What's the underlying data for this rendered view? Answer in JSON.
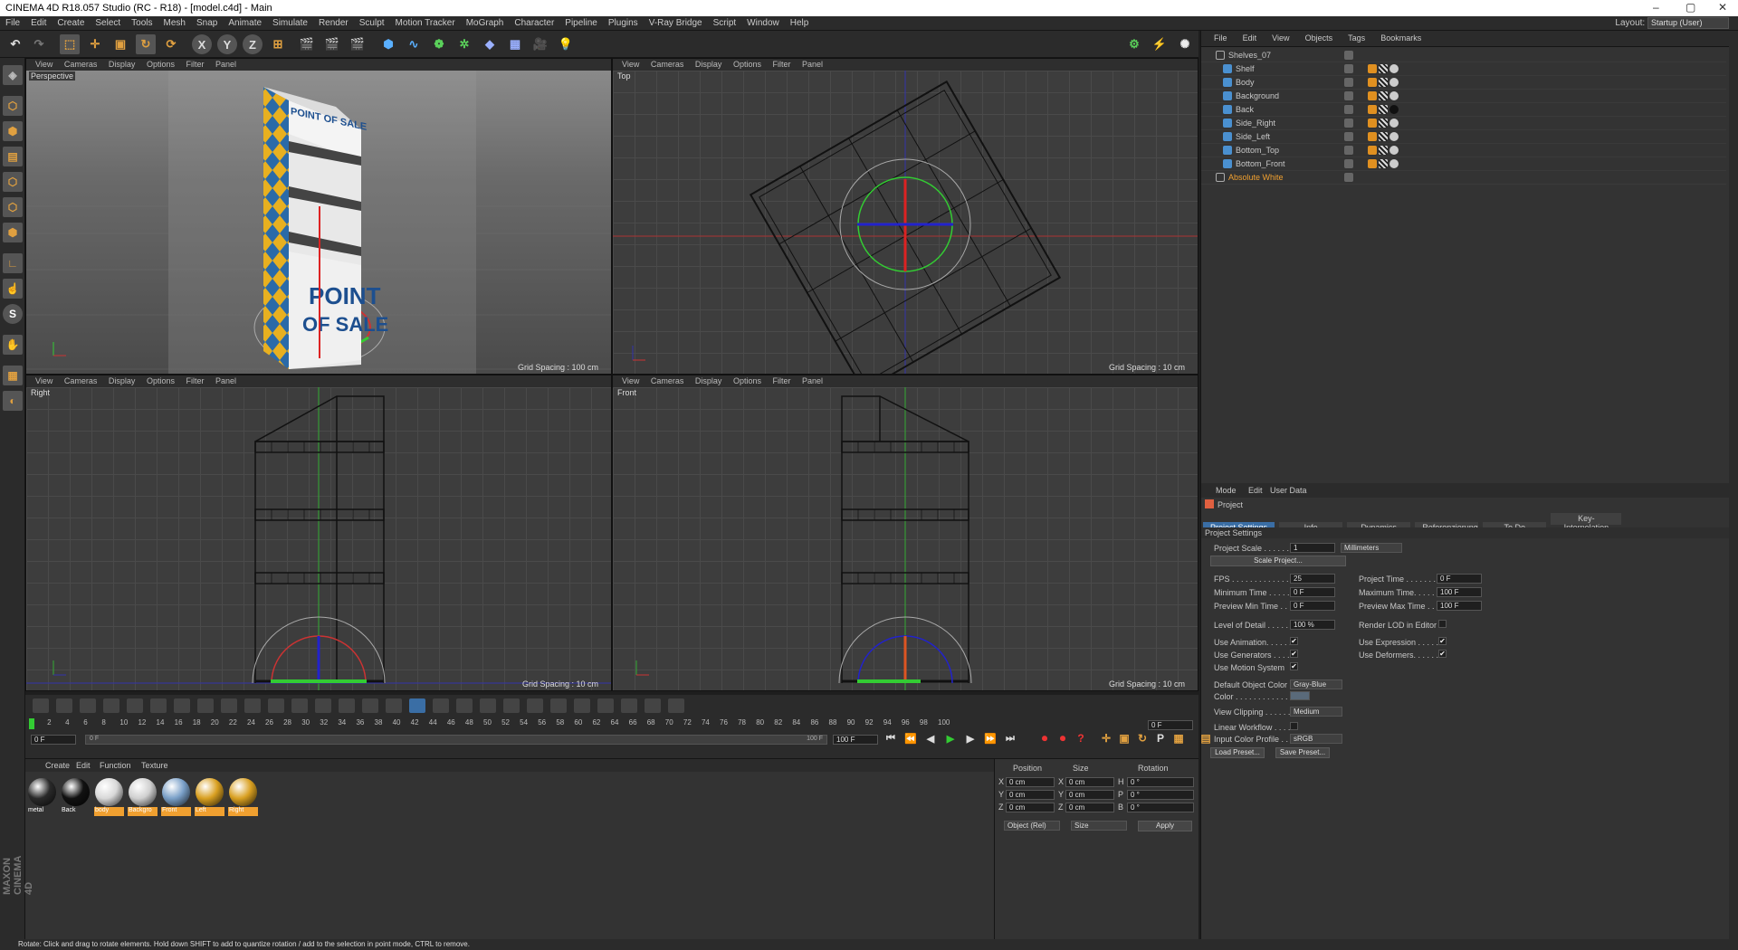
{
  "app": {
    "title": "CINEMA 4D R18.057 Studio (RC - R18) - [model.c4d] - Main",
    "window_controls": [
      "–",
      "▢",
      "✕"
    ],
    "layout_label": "Layout:",
    "layout_value": "Startup (User)"
  },
  "menu": [
    "File",
    "Edit",
    "Create",
    "Select",
    "Tools",
    "Mesh",
    "Snap",
    "Animate",
    "Simulate",
    "Render",
    "Sculpt",
    "Motion Tracker",
    "MoGraph",
    "Character",
    "Pipeline",
    "Plugins",
    "V-Ray Bridge",
    "Script",
    "Window",
    "Help"
  ],
  "toolbar": {
    "axis_x": "X",
    "axis_y": "Y",
    "axis_z": "Z"
  },
  "lefttools": {
    "s_label": "S"
  },
  "viewports": [
    {
      "name": "Perspective",
      "menu": [
        "View",
        "Cameras",
        "Display",
        "Options",
        "Filter",
        "Panel"
      ],
      "grid": "Grid Spacing : 100 cm"
    },
    {
      "name": "Top",
      "menu": [
        "View",
        "Cameras",
        "Display",
        "Options",
        "Filter",
        "Panel"
      ],
      "grid": "Grid Spacing : 10 cm"
    },
    {
      "name": "Right",
      "menu": [
        "View",
        "Cameras",
        "Display",
        "Options",
        "Filter",
        "Panel"
      ],
      "grid": "Grid Spacing : 10 cm"
    },
    {
      "name": "Front",
      "menu": [
        "View",
        "Cameras",
        "Display",
        "Options",
        "Filter",
        "Panel"
      ],
      "grid": "Grid Spacing : 10 cm"
    }
  ],
  "viewport_art": {
    "sign_top": "POINT OF SALE",
    "sign_bottom_1": "POINT",
    "sign_bottom_2": "OF SALE"
  },
  "objects_menu": [
    "File",
    "Edit",
    "View",
    "Objects",
    "Tags",
    "Bookmarks"
  ],
  "objects": [
    {
      "name": "Shelves_07",
      "type": "null"
    },
    {
      "name": "Shelf",
      "type": "mesh"
    },
    {
      "name": "Body",
      "type": "mesh"
    },
    {
      "name": "Background",
      "type": "mesh"
    },
    {
      "name": "Back",
      "type": "mesh"
    },
    {
      "name": "Side_Right",
      "type": "mesh"
    },
    {
      "name": "Side_Left",
      "type": "mesh"
    },
    {
      "name": "Bottom_Top",
      "type": "mesh"
    },
    {
      "name": "Bottom_Front",
      "type": "mesh"
    },
    {
      "name": "Absolute White",
      "type": "null",
      "highlight": true
    }
  ],
  "attr_menu": [
    "Mode",
    "Edit",
    "User Data"
  ],
  "attr_title": "Project",
  "attr_tabs": [
    "Project Settings",
    "Info",
    "Dynamics",
    "Referenzierung",
    "To Do",
    "Key-Interpolation"
  ],
  "attr_section": "Project Settings",
  "project": {
    "scale_label": "Project Scale . . . . . .",
    "scale_value": "1",
    "scale_unit": "Millimeters",
    "scale_button": "Scale Project...",
    "fps_label": "FPS . . . . . . . . . . . . . .",
    "fps": "25",
    "project_time_label": "Project Time . . . . . . .",
    "project_time": "0 F",
    "min_time_label": "Minimum Time . . . . . .",
    "min_time": "0 F",
    "max_time_label": "Maximum Time. . . . . .",
    "max_time": "100 F",
    "prev_min_label": "Preview Min Time . . .",
    "prev_min": "0 F",
    "prev_max_label": "Preview Max Time . . .",
    "prev_max": "100 F",
    "lod_label": "Level of Detail . . . . .",
    "lod": "100 %",
    "render_lod_label": "Render LOD in Editor",
    "use_animation_label": "Use Animation. . . . . .",
    "use_expression_label": "Use Expression . . . . .",
    "use_generators_label": "Use Generators . . . . .",
    "use_deformers_label": "Use Deformers. . . . . .",
    "use_motion_label": "Use Motion System",
    "default_color_label": "Default Object Color",
    "default_color": "Gray-Blue",
    "color_label": "Color . . . . . . . . . . . . .",
    "view_clip_label": "View Clipping . . . . . .",
    "view_clip": "Medium",
    "linear_label": "Linear Workflow . . . .",
    "input_profile_label": "Input Color Profile . .",
    "input_profile": "sRGB",
    "load_preset": "Load Preset...",
    "save_preset": "Save Preset...",
    "check": "✔"
  },
  "timeline": {
    "ticks": [
      "0",
      "2",
      "4",
      "6",
      "8",
      "10",
      "12",
      "14",
      "16",
      "18",
      "20",
      "22",
      "24",
      "26",
      "28",
      "30",
      "32",
      "34",
      "36",
      "38",
      "40",
      "42",
      "44",
      "46",
      "48",
      "50",
      "52",
      "54",
      "56",
      "58",
      "60",
      "62",
      "64",
      "66",
      "68",
      "70",
      "72",
      "74",
      "76",
      "78",
      "80",
      "82",
      "84",
      "86",
      "88",
      "90",
      "92",
      "94",
      "96",
      "98",
      "100"
    ],
    "current": "0 F",
    "start": "0 F",
    "slider_left": "0 F",
    "slider_right": "100 F",
    "end": "100 F",
    "frame_field": "0 F"
  },
  "materials_menu": [
    "Create",
    "Edit",
    "Function",
    "Texture"
  ],
  "materials": [
    {
      "name": "metal",
      "color": "#2a2a2a",
      "selected": false
    },
    {
      "name": "Back",
      "color": "#111111",
      "selected": false
    },
    {
      "name": "body",
      "color": "#d8d8d8",
      "selected": true
    },
    {
      "name": "Backgro",
      "color": "#d0d0d0",
      "selected": true
    },
    {
      "name": "Front",
      "color": "#7aa0c8",
      "selected": true
    },
    {
      "name": "Left",
      "color": "#d9a021",
      "selected": true
    },
    {
      "name": "Right",
      "color": "#d9a021",
      "selected": true
    }
  ],
  "coords": {
    "headers": [
      "Position",
      "Size",
      "Rotation"
    ],
    "rows": [
      {
        "axis": "X",
        "pos": "0 cm",
        "size_axis": "X",
        "size": "0 cm",
        "rot_axis": "H",
        "rot": "0 °"
      },
      {
        "axis": "Y",
        "pos": "0 cm",
        "size_axis": "Y",
        "size": "0 cm",
        "rot_axis": "P",
        "rot": "0 °"
      },
      {
        "axis": "Z",
        "pos": "0 cm",
        "size_axis": "Z",
        "size": "0 cm",
        "rot_axis": "B",
        "rot": "0 °"
      }
    ],
    "mode": "Object (Rel)",
    "size_mode": "Size",
    "apply": "Apply"
  },
  "brand": "MAXON CINEMA 4D",
  "status": "Rotate: Click and drag to rotate elements. Hold down SHIFT to add to quantize rotation / add to the selection in point mode, CTRL to remove.",
  "colors": {
    "accent": "#f0a030",
    "selection": "#3a6ea5"
  }
}
